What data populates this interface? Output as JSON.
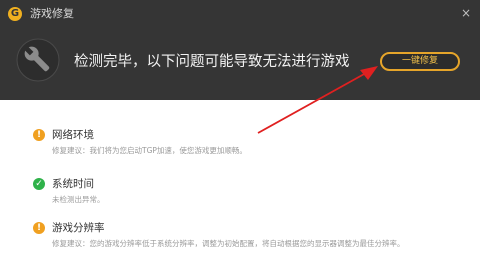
{
  "window": {
    "title": "游戏修复",
    "logo_letter": "G",
    "close_glyph": "×"
  },
  "header": {
    "headline": "检测完毕，以下问题可能导致无法进行游戏",
    "fix_button_label": "一键修复"
  },
  "issues": [
    {
      "status": "warning",
      "status_glyph": "!",
      "title": "网络环境",
      "desc": "修复建议：我们将为您启动TGP加速，使您游戏更加顺畅。"
    },
    {
      "status": "ok",
      "status_glyph": "✓",
      "title": "系统时间",
      "desc": "未检测出异常。"
    },
    {
      "status": "warning",
      "status_glyph": "!",
      "title": "游戏分辨率",
      "desc": "修复建议：您的游戏分辨率低于系统分辨率，调整为初始配置，将自动根据您的显示器调整为最佳分辨率。"
    }
  ],
  "colors": {
    "header_bg": "#353535",
    "accent": "#e6a52a",
    "warning": "#f0a020",
    "ok": "#2fb24a",
    "annotation_arrow": "#e02020"
  }
}
